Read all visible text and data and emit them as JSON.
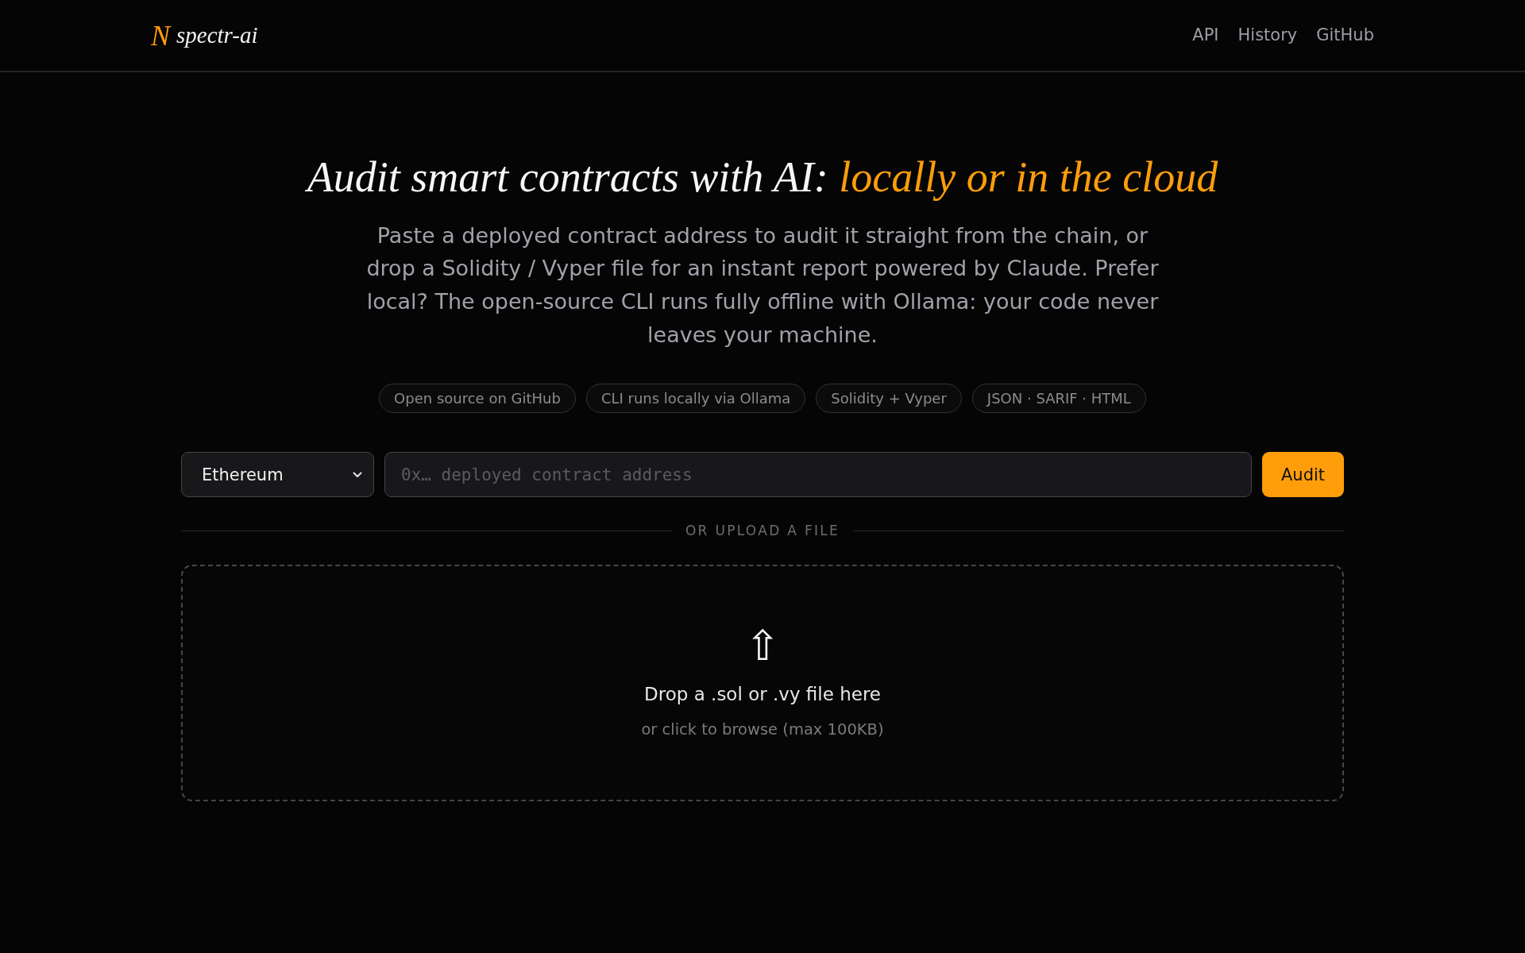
{
  "header": {
    "logo": {
      "mark": "N",
      "name": "spectr-ai"
    },
    "nav": [
      {
        "label": "API"
      },
      {
        "label": "History"
      },
      {
        "label": "GitHub"
      }
    ]
  },
  "hero": {
    "title": "Audit smart contracts with AI:",
    "title_highlight": "locally or in the cloud",
    "description": "Paste a deployed contract address to audit it straight from the chain, or drop a Solidity / Vyper file for an instant report powered by Claude. Prefer local? The open-source CLI runs fully offline with Ollama: your code never leaves your machine.",
    "tags": [
      "Open source on GitHub",
      "CLI runs locally via Ollama",
      "Solidity + Vyper",
      "JSON · SARIF · HTML"
    ]
  },
  "audit_form": {
    "network": "Ethereum",
    "address_placeholder": "0x… deployed contract address",
    "submit": "Audit"
  },
  "divider": "OR UPLOAD A FILE",
  "upload": {
    "icon": "⇧",
    "title": "Drop a .sol or .vy file here",
    "hint": "or click to browse (max 100KB)"
  }
}
